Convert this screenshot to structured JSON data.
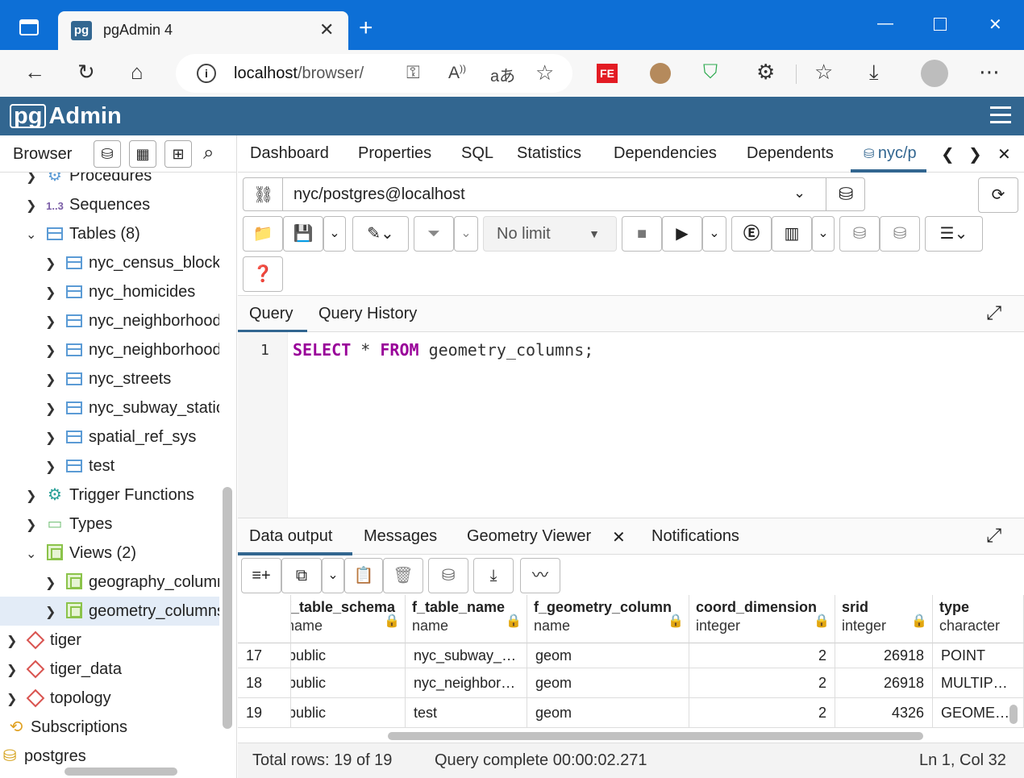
{
  "browser": {
    "tab_title": "pgAdmin 4",
    "url_host": "localhost",
    "url_path": "/browser/"
  },
  "app": {
    "logo_pg": "pg",
    "logo_text": "Admin"
  },
  "browser_panel": {
    "title": "Browser",
    "tree": [
      {
        "label": "Procedures",
        "level": 1,
        "icon": "procedure-icon",
        "chev": "›",
        "partial": true
      },
      {
        "label": "Sequences",
        "level": 1,
        "icon": "sequence-icon",
        "chev": "›"
      },
      {
        "label": "Tables (8)",
        "level": 1,
        "icon": "tables-icon",
        "chev": "⌄"
      },
      {
        "label": "nyc_census_blocks",
        "level": 2,
        "icon": "table-icon",
        "chev": "›"
      },
      {
        "label": "nyc_homicides",
        "level": 2,
        "icon": "table-icon",
        "chev": "›"
      },
      {
        "label": "nyc_neighborhoods",
        "level": 2,
        "icon": "table-icon",
        "chev": "›"
      },
      {
        "label": "nyc_neighborhoods",
        "level": 2,
        "icon": "table-icon",
        "chev": "›"
      },
      {
        "label": "nyc_streets",
        "level": 2,
        "icon": "table-icon",
        "chev": "›"
      },
      {
        "label": "nyc_subway_stations",
        "level": 2,
        "icon": "table-icon",
        "chev": "›"
      },
      {
        "label": "spatial_ref_sys",
        "level": 2,
        "icon": "table-icon",
        "chev": "›"
      },
      {
        "label": "test",
        "level": 2,
        "icon": "table-icon",
        "chev": "›"
      },
      {
        "label": "Trigger Functions",
        "level": 1,
        "icon": "trigger-function-icon",
        "chev": "›"
      },
      {
        "label": "Types",
        "level": 1,
        "icon": "types-icon",
        "chev": "›"
      },
      {
        "label": "Views (2)",
        "level": 1,
        "icon": "views-icon",
        "chev": "⌄"
      },
      {
        "label": "geography_columns",
        "level": 2,
        "icon": "view-icon",
        "chev": "›"
      },
      {
        "label": "geometry_columns",
        "level": 2,
        "icon": "view-icon",
        "chev": "›",
        "selected": true
      },
      {
        "label": "tiger",
        "level": 0,
        "icon": "schema-icon",
        "chev": "›"
      },
      {
        "label": "tiger_data",
        "level": 0,
        "icon": "schema-icon",
        "chev": "›"
      },
      {
        "label": "topology",
        "level": 0,
        "icon": "schema-icon",
        "chev": "›"
      },
      {
        "label": "Subscriptions",
        "level": -1,
        "icon": "subscriptions-icon",
        "chev": ""
      },
      {
        "label": "postgres",
        "level": -2,
        "icon": "database-icon",
        "chev": ""
      }
    ]
  },
  "main_tabs": [
    "Dashboard",
    "Properties",
    "SQL",
    "Statistics",
    "Dependencies",
    "Dependents",
    "nyc/p"
  ],
  "query_tool": {
    "connection": "nyc/postgres@localhost",
    "limit": "No limit",
    "tabs": [
      "Query",
      "Query History"
    ],
    "line_number": "1",
    "code": {
      "kw1": "SELECT",
      "mid": " * ",
      "kw2": "FROM",
      "rest": " geometry_columns;"
    }
  },
  "output": {
    "tabs": [
      "Data output",
      "Messages",
      "Geometry Viewer",
      "Notifications"
    ],
    "columns": [
      {
        "name": "f_table_schema",
        "type": "name"
      },
      {
        "name": "f_table_name",
        "type": "name"
      },
      {
        "name": "f_geometry_column",
        "type": "name"
      },
      {
        "name": "coord_dimension",
        "type": "integer"
      },
      {
        "name": "srid",
        "type": "integer"
      },
      {
        "name": "type",
        "type": "character"
      }
    ],
    "rows": [
      {
        "n": "17",
        "cells": [
          "public",
          "nyc_subway_stations",
          "geom",
          "2",
          "26918",
          "POINT"
        ]
      },
      {
        "n": "18",
        "cells": [
          "public",
          "nyc_neighborhoods",
          "geom",
          "2",
          "26918",
          "MULTIPOLYGON"
        ]
      },
      {
        "n": "19",
        "cells": [
          "public",
          "test",
          "geom",
          "2",
          "4326",
          "GEOMETRY"
        ]
      }
    ]
  },
  "status": {
    "total_rows": "Total rows: 19 of 19",
    "query_complete": "Query complete 00:00:02.271",
    "cursor": "Ln 1, Col 32"
  },
  "colors": {
    "edge_blue": "#0d6fd6",
    "pgadmin_header": "#326690",
    "keyword": "#990099"
  }
}
